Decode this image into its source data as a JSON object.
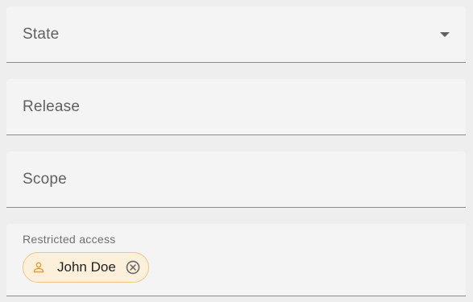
{
  "fields": {
    "state": {
      "label": "State",
      "icon": "arrow-drop-down-icon"
    },
    "release": {
      "label": "Release"
    },
    "scope": {
      "label": "Scope"
    },
    "restricted_access": {
      "label": "Restricted access",
      "chips": [
        {
          "label": "John Doe",
          "icon": "person-icon",
          "remove_icon": "cancel-circle-icon"
        }
      ]
    }
  },
  "colors": {
    "field_background": "#f4f4f4",
    "page_background": "#eeeeee",
    "underline": "#8a8a8a",
    "chip_background": "#fdf0da",
    "chip_border": "#f0c58a",
    "chip_icon": "#f0a030"
  }
}
